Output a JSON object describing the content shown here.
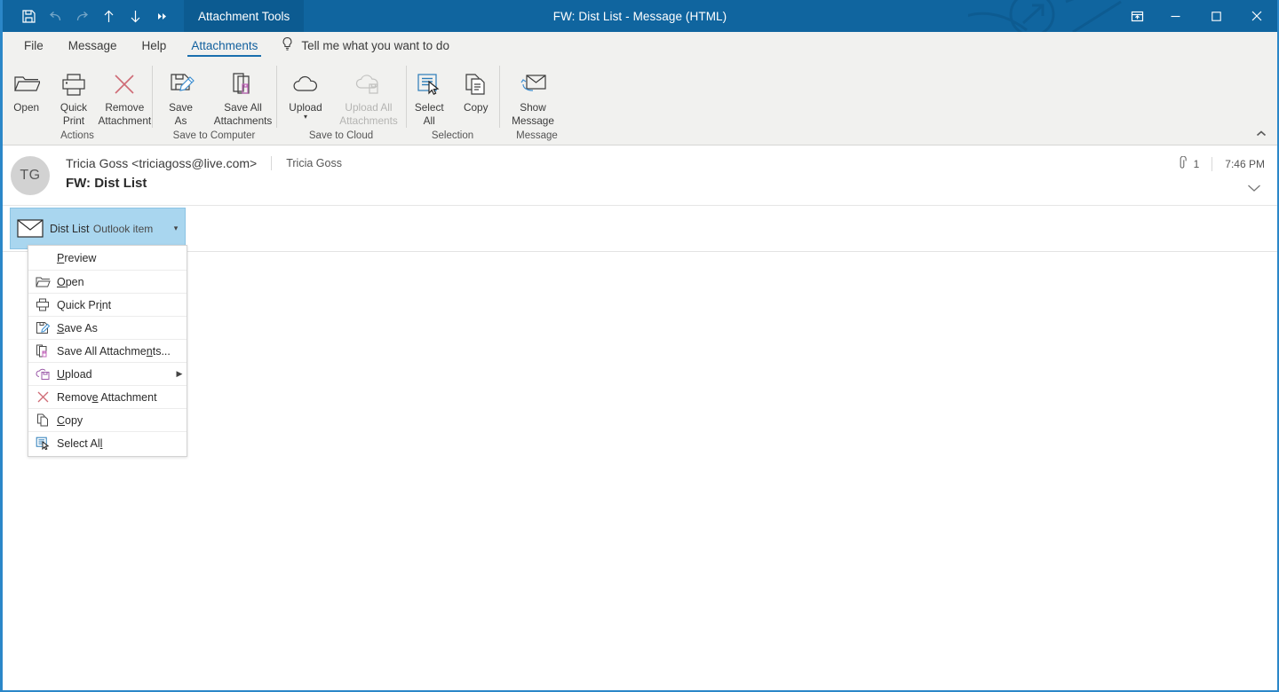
{
  "window": {
    "title": "FW: Dist List  -  Message (HTML)",
    "contextual_tab_group": "Attachment Tools",
    "titlebar_color": "#10659f",
    "contextual_tab_color": "#0c5b91",
    "accent_color": "#1a6fae"
  },
  "quick_access": [
    {
      "name": "save-icon",
      "label": "Save",
      "enabled": true
    },
    {
      "name": "undo-icon",
      "label": "Undo",
      "enabled": false
    },
    {
      "name": "redo-icon",
      "label": "Redo",
      "enabled": false
    },
    {
      "name": "previous-item-icon",
      "label": "Previous Item",
      "enabled": true
    },
    {
      "name": "next-item-icon",
      "label": "Next Item",
      "enabled": true
    },
    {
      "name": "customize-quick-access-toolbar-icon",
      "label": "Customize Quick Access Toolbar",
      "enabled": true
    }
  ],
  "window_controls": {
    "ribbon_display_options": "Ribbon Display Options",
    "minimize": "Minimize",
    "maximize": "Maximize",
    "close": "Close"
  },
  "ribbon_tabs": [
    {
      "label": "File",
      "active": false
    },
    {
      "label": "Message",
      "active": false
    },
    {
      "label": "Help",
      "active": false
    },
    {
      "label": "Attachments",
      "active": true
    }
  ],
  "tell_me": {
    "placeholder": "Tell me what you want to do",
    "icon": "lightbulb-icon"
  },
  "ribbon_groups": [
    {
      "label": "Actions",
      "buttons": [
        {
          "label": "Open",
          "icon": "open-folder-icon",
          "enabled": true,
          "dropdown": false
        },
        {
          "label": "Quick\nPrint",
          "icon": "printer-icon",
          "enabled": true,
          "dropdown": false
        },
        {
          "label": "Remove\nAttachment",
          "icon": "remove-x-icon",
          "enabled": true,
          "dropdown": false
        }
      ]
    },
    {
      "label": "Save to Computer",
      "buttons": [
        {
          "label": "Save\nAs",
          "icon": "save-as-icon",
          "enabled": true,
          "dropdown": false
        },
        {
          "label": "Save All\nAttachments",
          "icon": "save-all-attachments-icon",
          "enabled": true,
          "dropdown": false
        }
      ]
    },
    {
      "label": "Save to Cloud",
      "buttons": [
        {
          "label": "Upload",
          "icon": "cloud-upload-icon",
          "enabled": true,
          "dropdown": true
        },
        {
          "label": "Upload All\nAttachments",
          "icon": "cloud-upload-all-icon",
          "enabled": false,
          "dropdown": true
        }
      ]
    },
    {
      "label": "Selection",
      "buttons": [
        {
          "label": "Select\nAll",
          "icon": "select-all-icon",
          "enabled": true,
          "dropdown": false
        },
        {
          "label": "Copy",
          "icon": "copy-icon",
          "enabled": true,
          "dropdown": false
        }
      ]
    },
    {
      "label": "Message",
      "buttons": [
        {
          "label": "Show\nMessage",
          "icon": "show-message-envelope-icon",
          "enabled": true,
          "dropdown": false
        }
      ]
    }
  ],
  "collapse_ribbon": "Collapse the Ribbon",
  "message": {
    "avatar_initials": "TG",
    "from": "Tricia Goss <triciagoss@live.com>",
    "to": "Tricia Goss",
    "subject": "FW: Dist List",
    "attachment_count": "1",
    "time": "7:46 PM",
    "expand_icon": "chevron-down-icon",
    "attachment_icon": "paperclip-icon"
  },
  "attachment": {
    "name": "Dist List",
    "type": "Outlook item",
    "icon": "envelope-icon",
    "caret": "▾",
    "selected": true,
    "selected_color": "#a9d6ef"
  },
  "context_menu": {
    "items": [
      {
        "label": "Preview",
        "accel_index": 0,
        "icon": null,
        "submenu": false,
        "separator_above": false
      },
      {
        "label": "Open",
        "accel_index": 0,
        "icon": "open-folder-icon",
        "submenu": false,
        "separator_above": true
      },
      {
        "label": "Quick Print",
        "accel_index": 8,
        "icon": "printer-icon",
        "submenu": false,
        "separator_above": true
      },
      {
        "label": "Save As",
        "accel_index": 0,
        "icon": "save-as-icon",
        "submenu": false,
        "separator_above": true
      },
      {
        "label": "Save All Attachments...",
        "accel_index": 16,
        "icon": "save-all-attachments-icon",
        "submenu": false,
        "separator_above": true
      },
      {
        "label": "Upload",
        "accel_index": 0,
        "icon": "cloud-upload-icon",
        "submenu": true,
        "separator_above": true
      },
      {
        "label": "Remove Attachment",
        "accel_index": 5,
        "icon": "remove-x-icon",
        "submenu": false,
        "separator_above": true
      },
      {
        "label": "Copy",
        "accel_index": 0,
        "icon": "copy-icon",
        "submenu": false,
        "separator_above": true
      },
      {
        "label": "Select All",
        "accel_index": 9,
        "icon": "select-all-icon",
        "submenu": false,
        "separator_above": true
      }
    ],
    "submenu_arrow": "▶"
  }
}
